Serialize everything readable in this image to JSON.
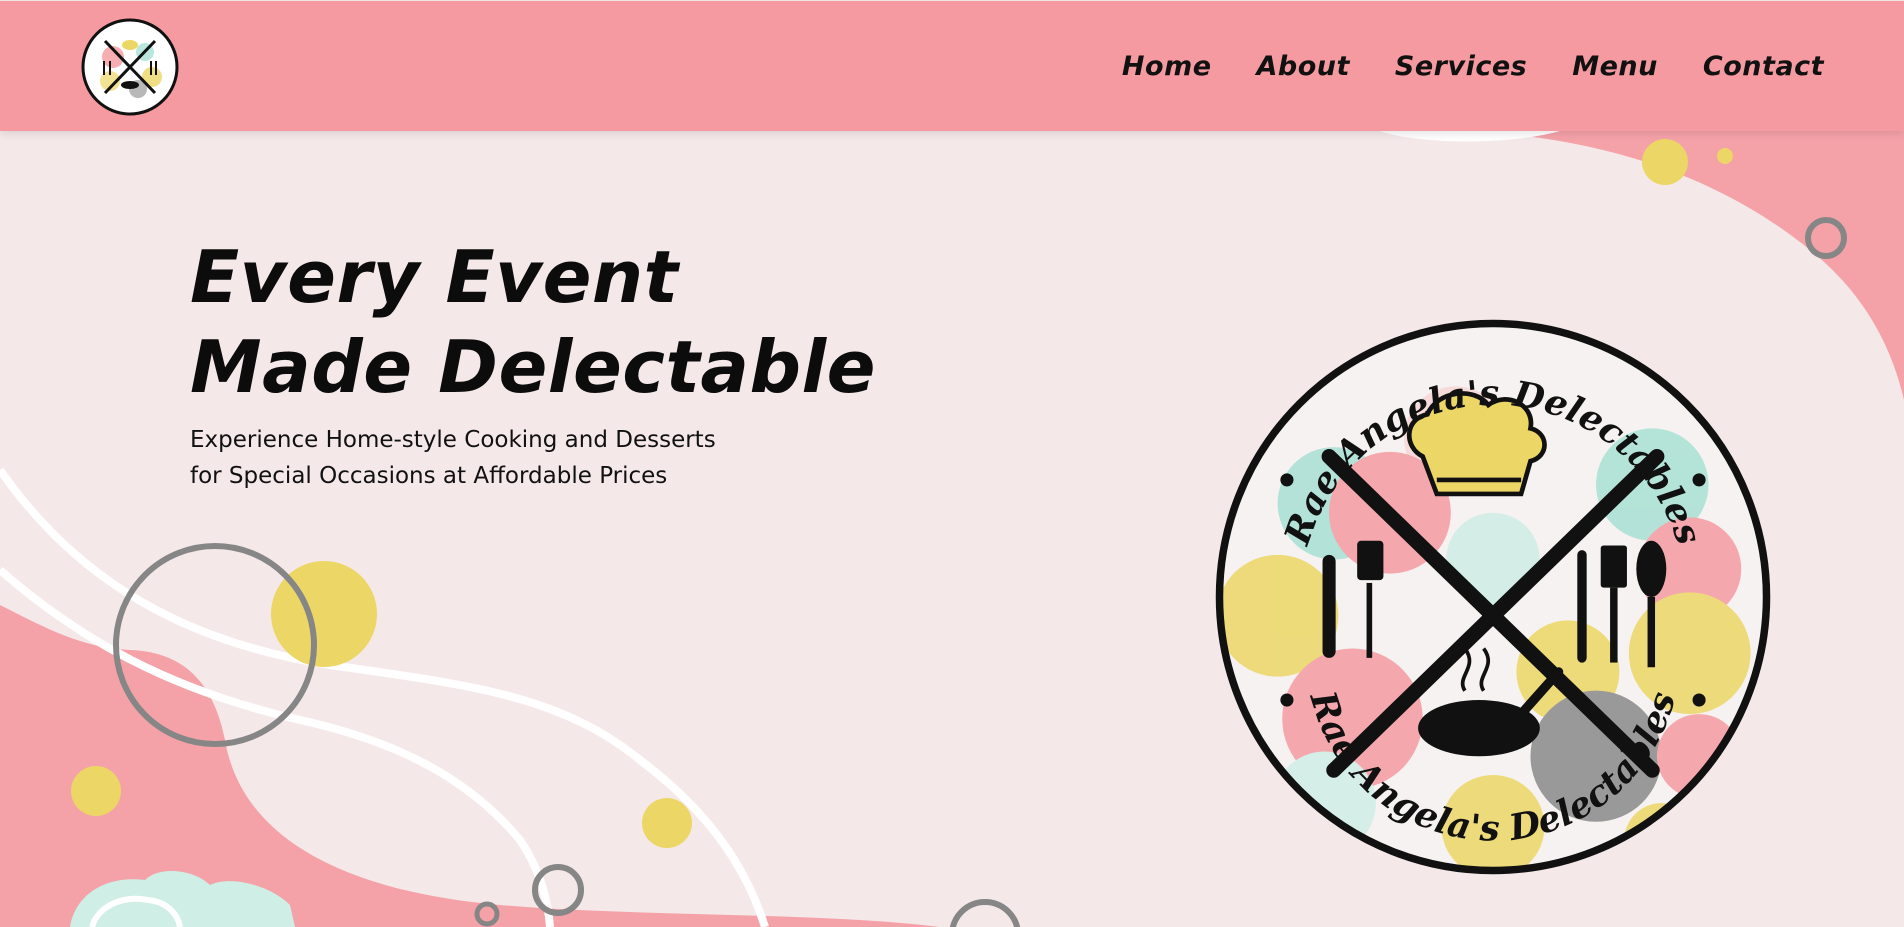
{
  "brand": {
    "name": "Rae Angela's Delectables",
    "logo_text_top": "Rae Angela's Delectables",
    "logo_text_bottom": "Rae Angela's Delectables"
  },
  "nav": {
    "links": [
      "Home",
      "About",
      "Services",
      "Menu",
      "Contact"
    ]
  },
  "hero": {
    "title_line1": "Every Event",
    "title_line2": "Made Delectable",
    "subtitle_line1": "Experience Home-style Cooking and Desserts",
    "subtitle_line2": "for Special Occasions at Affordable Prices"
  },
  "colors": {
    "navbar": "#f49aa0",
    "background": "#f5e8e9",
    "pink_blob": "#f4a2a8",
    "yellow_dot": "#ecd665",
    "gray_ring": "#868686",
    "mint": "#cfeee6"
  }
}
